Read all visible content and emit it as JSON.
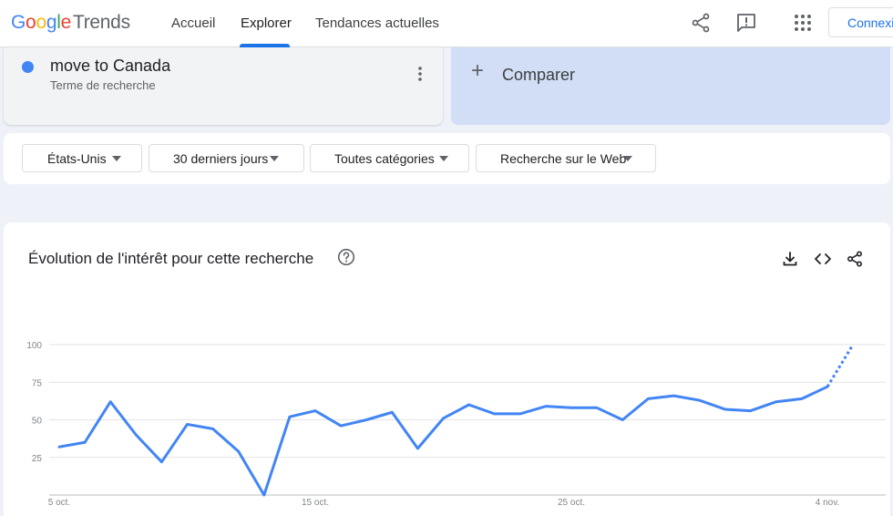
{
  "header": {
    "logo": {
      "google": "Google",
      "trends": "Trends"
    },
    "nav": [
      {
        "label": "Accueil"
      },
      {
        "label": "Explorer"
      },
      {
        "label": "Tendances actuelles"
      }
    ],
    "icons": [
      "share-icon",
      "feedback-icon",
      "apps-icon"
    ],
    "signin_label": "Connexion"
  },
  "term": {
    "title": "move to Canada",
    "subtitle": "Terme de recherche",
    "color": "#4285f4"
  },
  "compare": {
    "label": "Comparer"
  },
  "filters": [
    {
      "label": "États-Unis"
    },
    {
      "label": "30 derniers jours"
    },
    {
      "label": "Toutes catégories"
    },
    {
      "label": "Recherche sur le Web"
    }
  ],
  "chart_card": {
    "title": "Évolution de l'intérêt pour cette recherche",
    "icons": [
      "help-icon",
      "download-icon",
      "embed-icon",
      "share-icon"
    ]
  },
  "chart_data": {
    "type": "line",
    "title": "",
    "xlabel": "",
    "ylabel": "",
    "ylim": [
      0,
      100
    ],
    "yticks": [
      25,
      50,
      75,
      100
    ],
    "x_ticks": [
      {
        "label": "5 oct.",
        "index": 0
      },
      {
        "label": "15 oct.",
        "index": 10
      },
      {
        "label": "25 oct.",
        "index": 20
      },
      {
        "label": "4 nov.",
        "index": 30
      }
    ],
    "series": [
      {
        "color": "#4285f4",
        "values": [
          32,
          35,
          62,
          40,
          22,
          47,
          44,
          29,
          0,
          52,
          56,
          46,
          50,
          55,
          31,
          51,
          60,
          54,
          54,
          59,
          58,
          58,
          50,
          64,
          66,
          63,
          57,
          56,
          62,
          64,
          72,
          100
        ],
        "partial_from_index": 30
      }
    ],
    "grid": true,
    "legend": "none"
  }
}
